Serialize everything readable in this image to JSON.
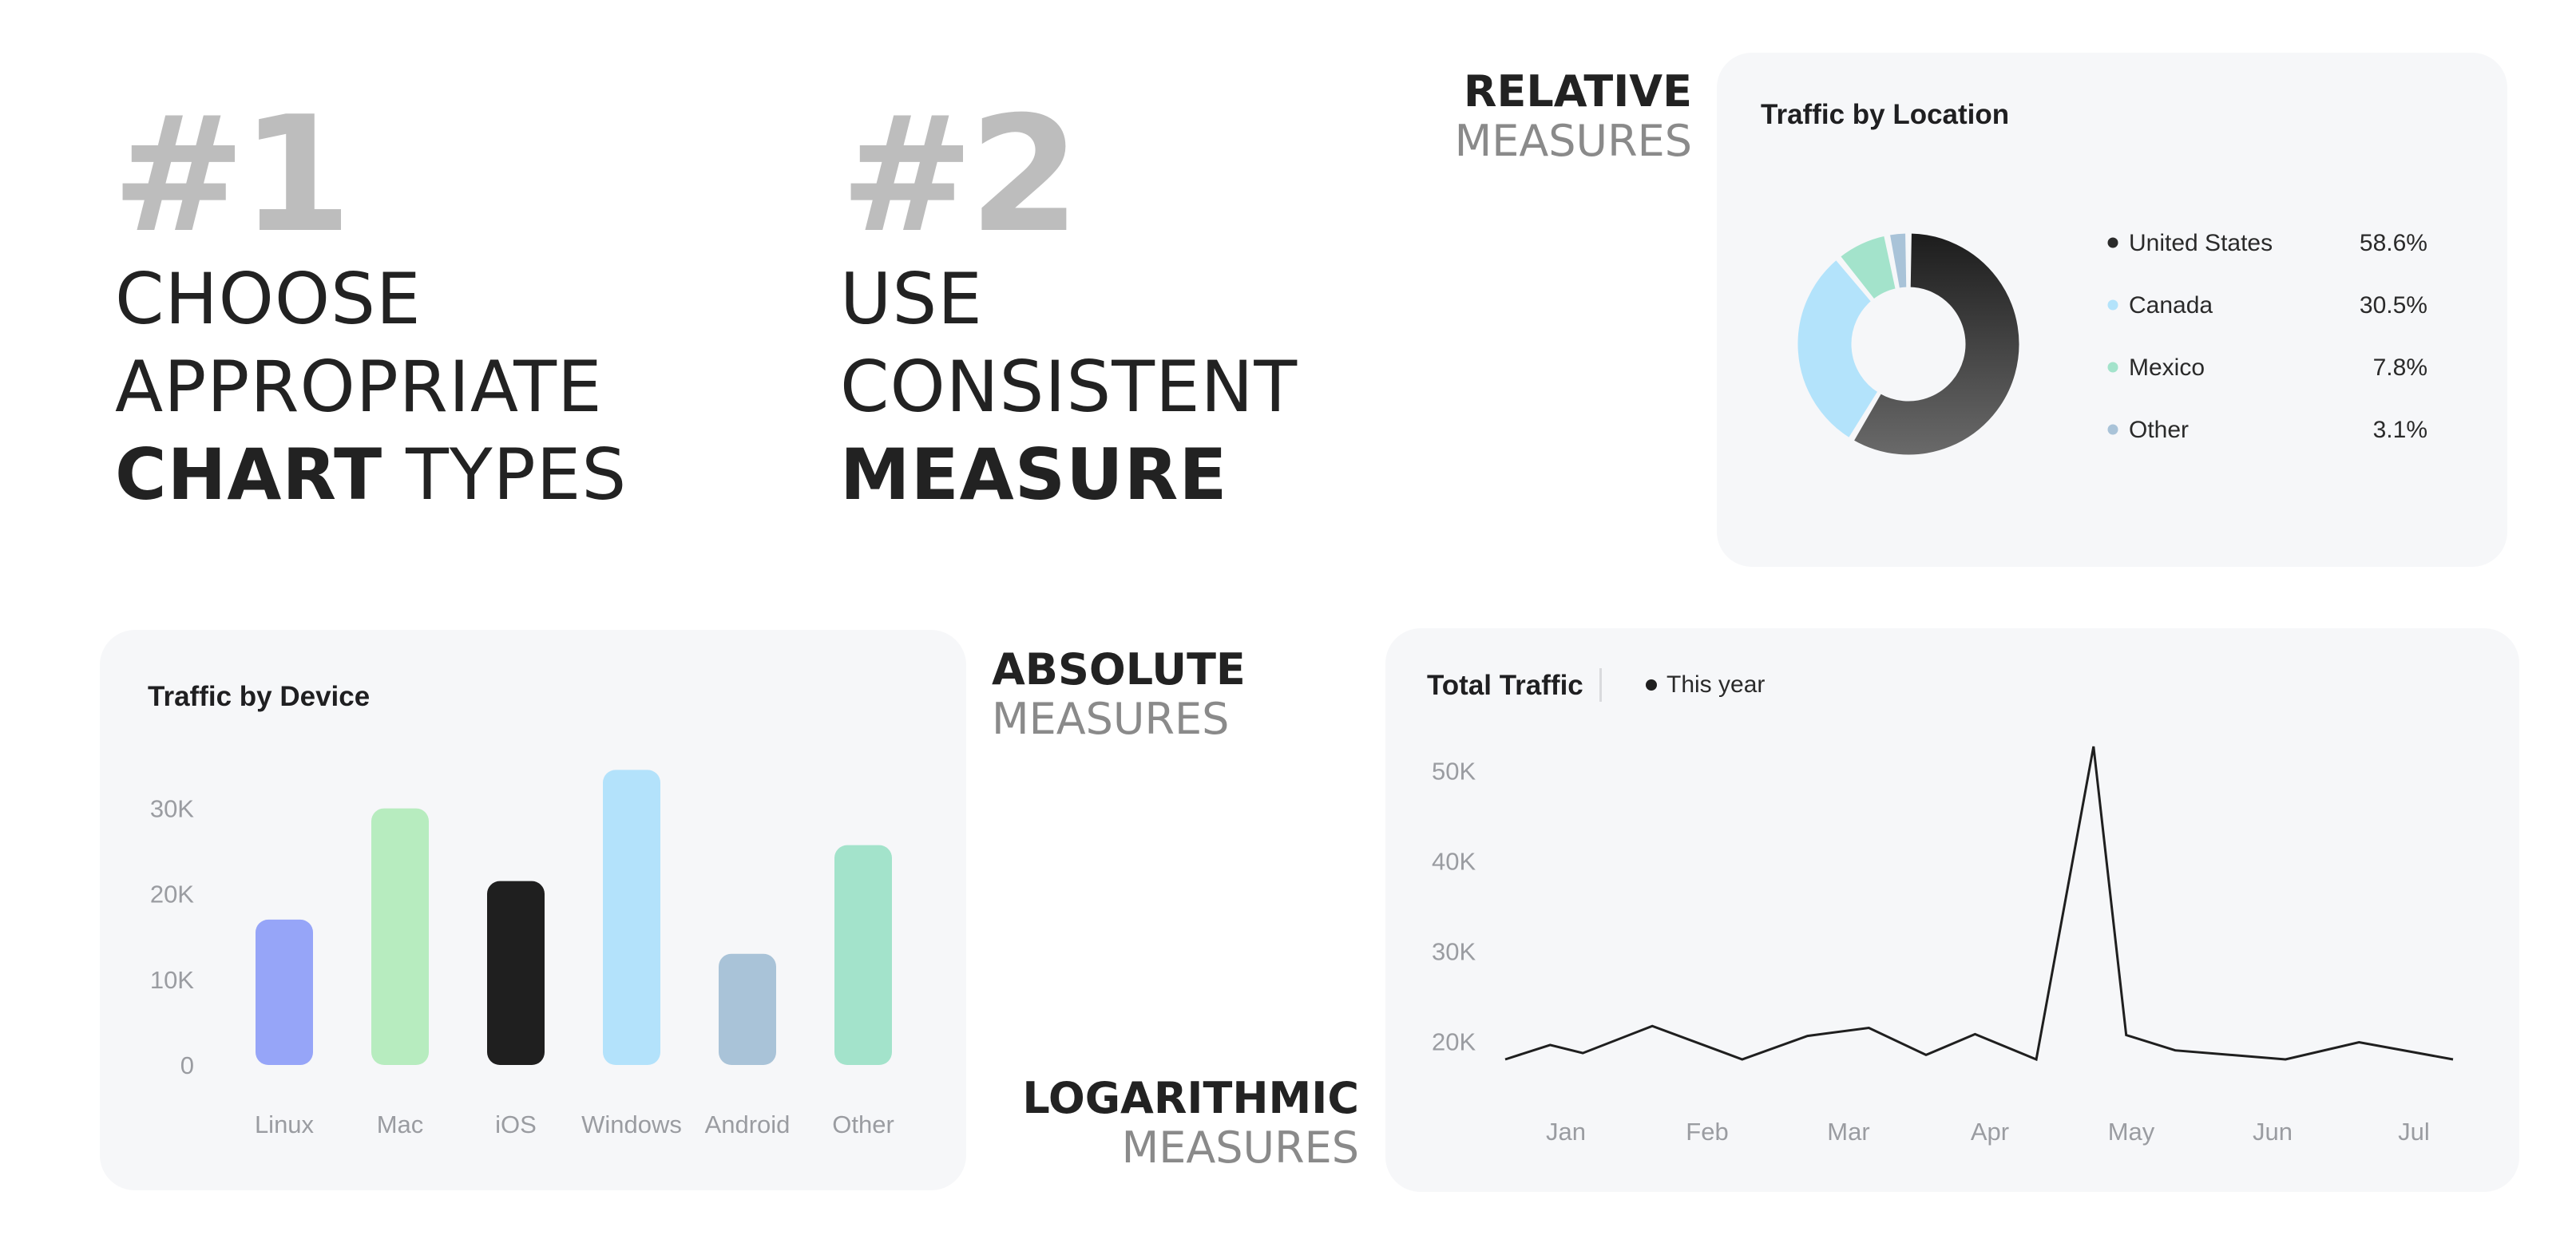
{
  "principles": [
    {
      "number": "#1",
      "lines": [
        [
          "CHOOSE"
        ],
        [
          "APPROPRIATE"
        ],
        [
          "CHART",
          " TYPES"
        ]
      ]
    },
    {
      "number": "#2",
      "lines": [
        [
          "USE"
        ],
        [
          "CONSISTENT"
        ],
        [
          "MEASURE"
        ]
      ]
    }
  ],
  "measure_labels": {
    "relative": {
      "strong": "RELATIVE",
      "light": "MEASURES"
    },
    "absolute": {
      "strong": "ABSOLUTE",
      "light": "MEASURES"
    },
    "logarithmic": {
      "strong": "LOGARITHMIC",
      "light": "MEASURES"
    }
  },
  "chart_data": [
    {
      "type": "pie",
      "title": "Traffic by Location",
      "donut": true,
      "slices": [
        {
          "label": "United States",
          "value": 58.6,
          "value_label": "58.6%",
          "color": "#2b2b2b"
        },
        {
          "label": "Canada",
          "value": 30.5,
          "value_label": "30.5%",
          "color": "#b3e3fb"
        },
        {
          "label": "Mexico",
          "value": 7.8,
          "value_label": "7.8%",
          "color": "#a3e3cb"
        },
        {
          "label": "Other",
          "value": 3.1,
          "value_label": "3.1%",
          "color": "#a9c3d8"
        }
      ],
      "legend": "right"
    },
    {
      "type": "bar",
      "title": "Traffic by Device",
      "categories": [
        "Linux",
        "Mac",
        "iOS",
        "Windows",
        "Android",
        "Other"
      ],
      "values": [
        17000,
        30000,
        21500,
        34500,
        13000,
        25700
      ],
      "colors": [
        "#96a5f8",
        "#b7ecbf",
        "#1f1f1f",
        "#b3e2fb",
        "#a9c3d8",
        "#a3e3cb"
      ],
      "yticks": [
        "0",
        "10K",
        "20K",
        "30K"
      ],
      "ylim": [
        0,
        35000
      ],
      "grid": false
    },
    {
      "type": "line",
      "title": "Total Traffic",
      "series": [
        {
          "name": "This year",
          "color": "#1f1f1f",
          "points": [
            [
              "2024-01-01",
              18000
            ],
            [
              "2024-01-12",
              19600
            ],
            [
              "2024-01-20",
              18700
            ],
            [
              "2024-02-06",
              21700
            ],
            [
              "2024-02-28",
              18000
            ],
            [
              "2024-03-15",
              20600
            ],
            [
              "2024-03-30",
              21500
            ],
            [
              "2024-04-13",
              18500
            ],
            [
              "2024-04-25",
              20800
            ],
            [
              "2024-05-10",
              18000
            ],
            [
              "2024-05-24",
              52700
            ],
            [
              "2024-06-01",
              20700
            ],
            [
              "2024-06-13",
              19000
            ],
            [
              "2024-07-10",
              18000
            ],
            [
              "2024-07-28",
              19900
            ],
            [
              "2024-08-20",
              18000
            ]
          ]
        }
      ],
      "xticks": [
        "Jan",
        "Feb",
        "Mar",
        "Apr",
        "May",
        "Jun",
        "Jul"
      ],
      "yticks": [
        "20K",
        "30K",
        "40K",
        "50K"
      ],
      "ylim": [
        15000,
        55000
      ],
      "legend": "top"
    }
  ]
}
